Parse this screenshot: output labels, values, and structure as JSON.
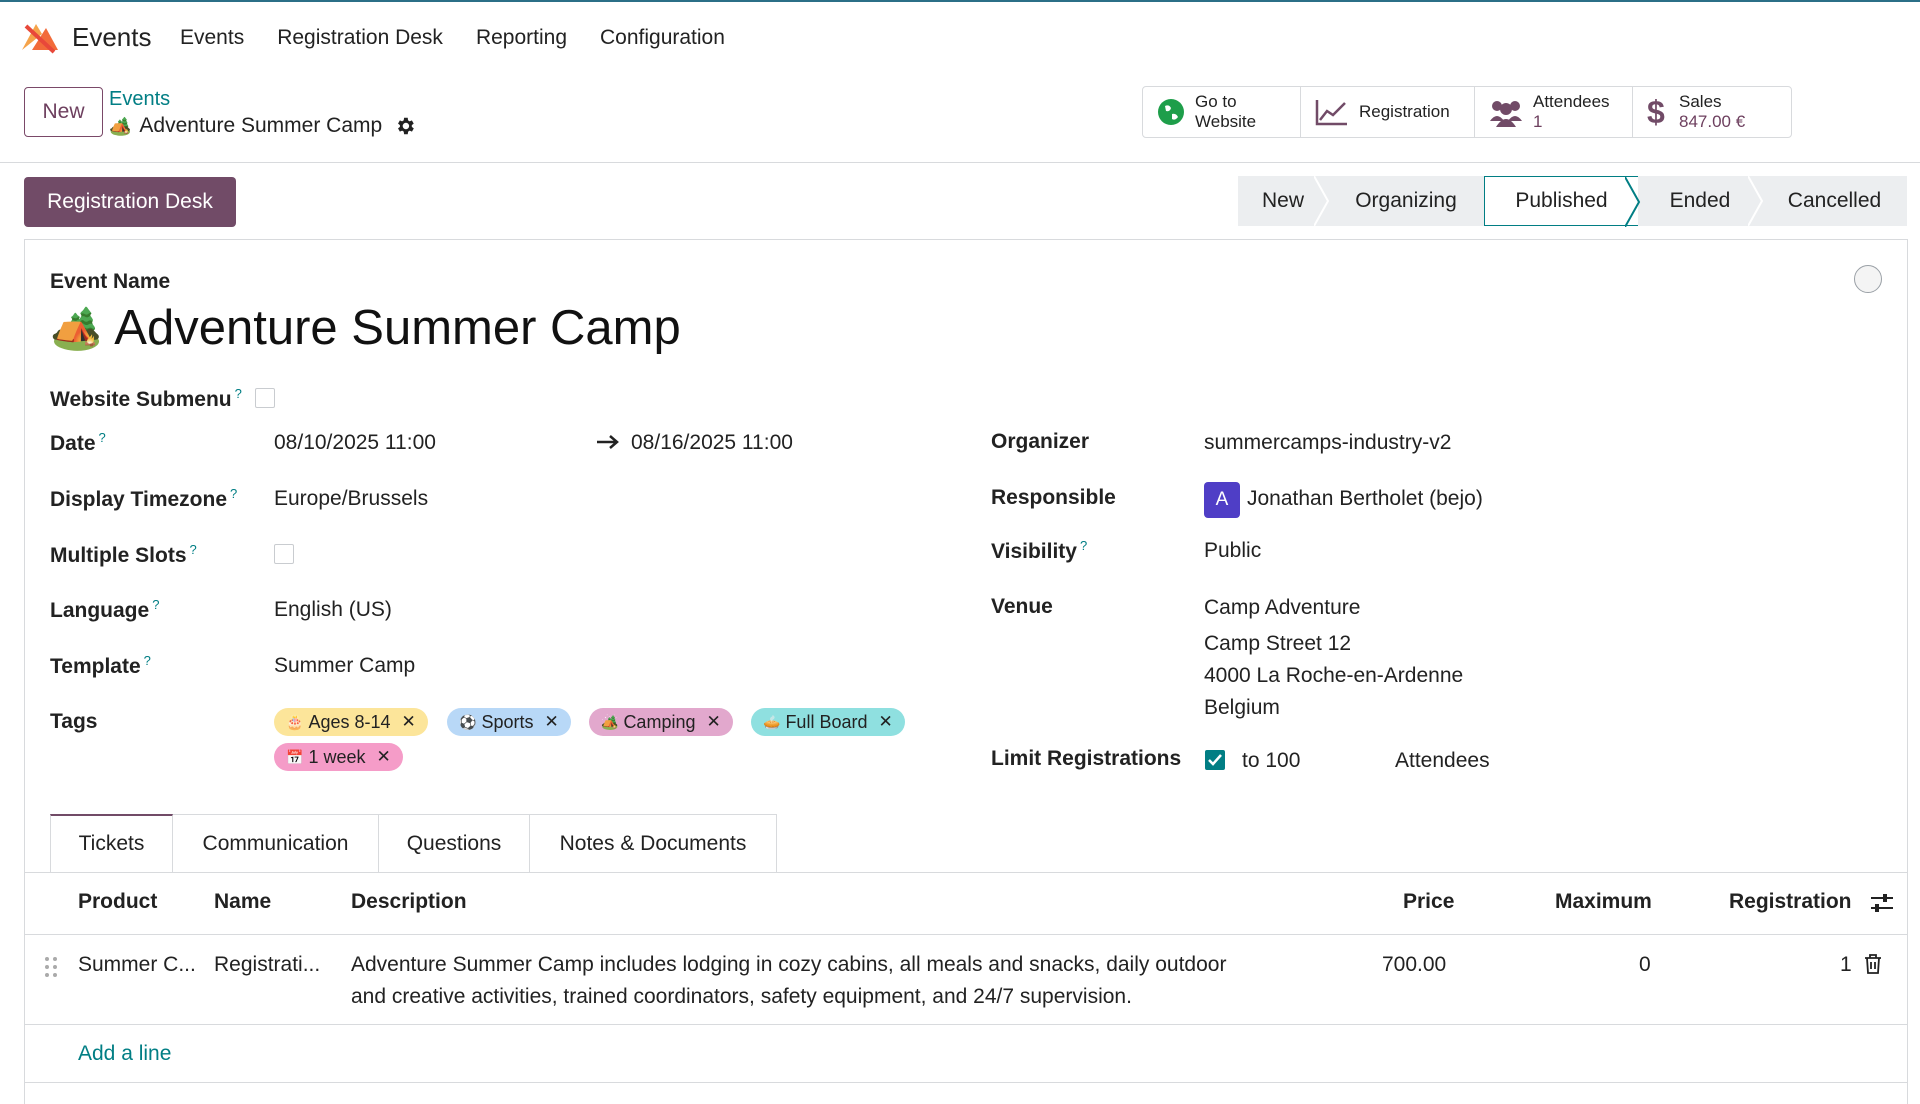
{
  "app": {
    "name": "Events"
  },
  "menu": [
    "Events",
    "Registration Desk",
    "Reporting",
    "Configuration"
  ],
  "control": {
    "new_label": "New",
    "breadcrumb_parent": "Events",
    "breadcrumb_current": "Adventure Summer Camp"
  },
  "smart_buttons": {
    "website_line1": "Go to",
    "website_line2": "Website",
    "registration": "Registration",
    "attendees_label": "Attendees",
    "attendees_count": "1",
    "sales_label": "Sales",
    "sales_value": "847.00 €"
  },
  "registration_desk_label": "Registration Desk",
  "stages": [
    "New",
    "Organizing",
    "Published",
    "Ended",
    "Cancelled"
  ],
  "active_stage": "Published",
  "form": {
    "event_name_label": "Event Name",
    "event_name": "Adventure Summer Camp",
    "website_submenu_label": "Website Submenu",
    "date_label": "Date",
    "date_start": "08/10/2025 11:00",
    "date_end": "08/16/2025 11:00",
    "timezone_label": "Display Timezone",
    "timezone": "Europe/Brussels",
    "multiple_slots_label": "Multiple Slots",
    "language_label": "Language",
    "language": "English (US)",
    "template_label": "Template",
    "template": "Summer Camp",
    "tags_label": "Tags",
    "tags": [
      {
        "label": "Ages 8-14",
        "icon": "🎂",
        "color": "#fce59a"
      },
      {
        "label": "Sports",
        "icon": "⚽",
        "color": "#b8d8f7"
      },
      {
        "label": "Camping",
        "icon": "🏕️",
        "color": "#e2a8cd"
      },
      {
        "label": "Full Board",
        "icon": "🥧",
        "color": "#8fe0e0"
      },
      {
        "label": "1 week",
        "icon": "📅",
        "color": "#f59cc8"
      }
    ],
    "organizer_label": "Organizer",
    "organizer": "summercamps-industry-v2",
    "responsible_label": "Responsible",
    "responsible_initial": "A",
    "responsible": "Jonathan Bertholet (bejo)",
    "visibility_label": "Visibility",
    "visibility": "Public",
    "venue_label": "Venue",
    "venue_line1": "Camp Adventure",
    "venue_line2": "Camp Street 12",
    "venue_line3": "4000 La Roche-en-Ardenne",
    "venue_line4": "Belgium",
    "limit_label": "Limit Registrations",
    "limit_to": "to 100",
    "limit_unit": "Attendees",
    "help_mark": "?"
  },
  "tabs": [
    "Tickets",
    "Communication",
    "Questions",
    "Notes & Documents"
  ],
  "tickets": {
    "headers": [
      "Product",
      "Name",
      "Description",
      "Price",
      "Maximum",
      "Registration"
    ],
    "rows": [
      {
        "product": "Summer C...",
        "name": "Registrati...",
        "description_line1": "Adventure Summer Camp includes lodging in cozy cabins, all meals and snacks, daily outdoor",
        "description_line2": "and creative activities, trained coordinators, safety equipment, and 24/7 supervision.",
        "price": "700.00",
        "maximum": "0",
        "registration": "1"
      }
    ],
    "add_line": "Add a line"
  },
  "colors": {
    "brand": "#714b67",
    "accent": "#017e84"
  }
}
